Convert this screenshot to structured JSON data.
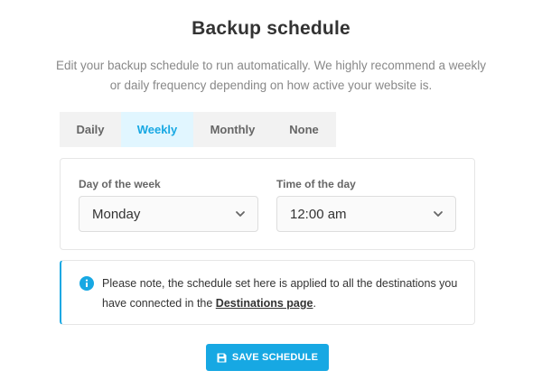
{
  "page": {
    "title": "Backup schedule",
    "description": "Edit your backup schedule to run automatically. We highly recommend a weekly or daily frequency depending on how active your website is."
  },
  "tabs": [
    {
      "label": "Daily",
      "active": false
    },
    {
      "label": "Weekly",
      "active": true
    },
    {
      "label": "Monthly",
      "active": false
    },
    {
      "label": "None",
      "active": false
    }
  ],
  "schedule": {
    "day_label": "Day of the week",
    "day_value": "Monday",
    "time_label": "Time of the day",
    "time_value": "12:00 am"
  },
  "notice": {
    "text_before": "Please note, the schedule set here is applied to all the destinations you have connected in the ",
    "link_text": "Destinations page",
    "text_after": "."
  },
  "actions": {
    "save_label": "SAVE SCHEDULE"
  },
  "icons": {
    "info": "info-icon",
    "chevron": "chevron-down-icon",
    "save": "floppy-disk-icon"
  },
  "colors": {
    "accent": "#17a8e3",
    "active_tab_bg": "#e1f6ff",
    "tab_bg": "#f2f2f2"
  }
}
